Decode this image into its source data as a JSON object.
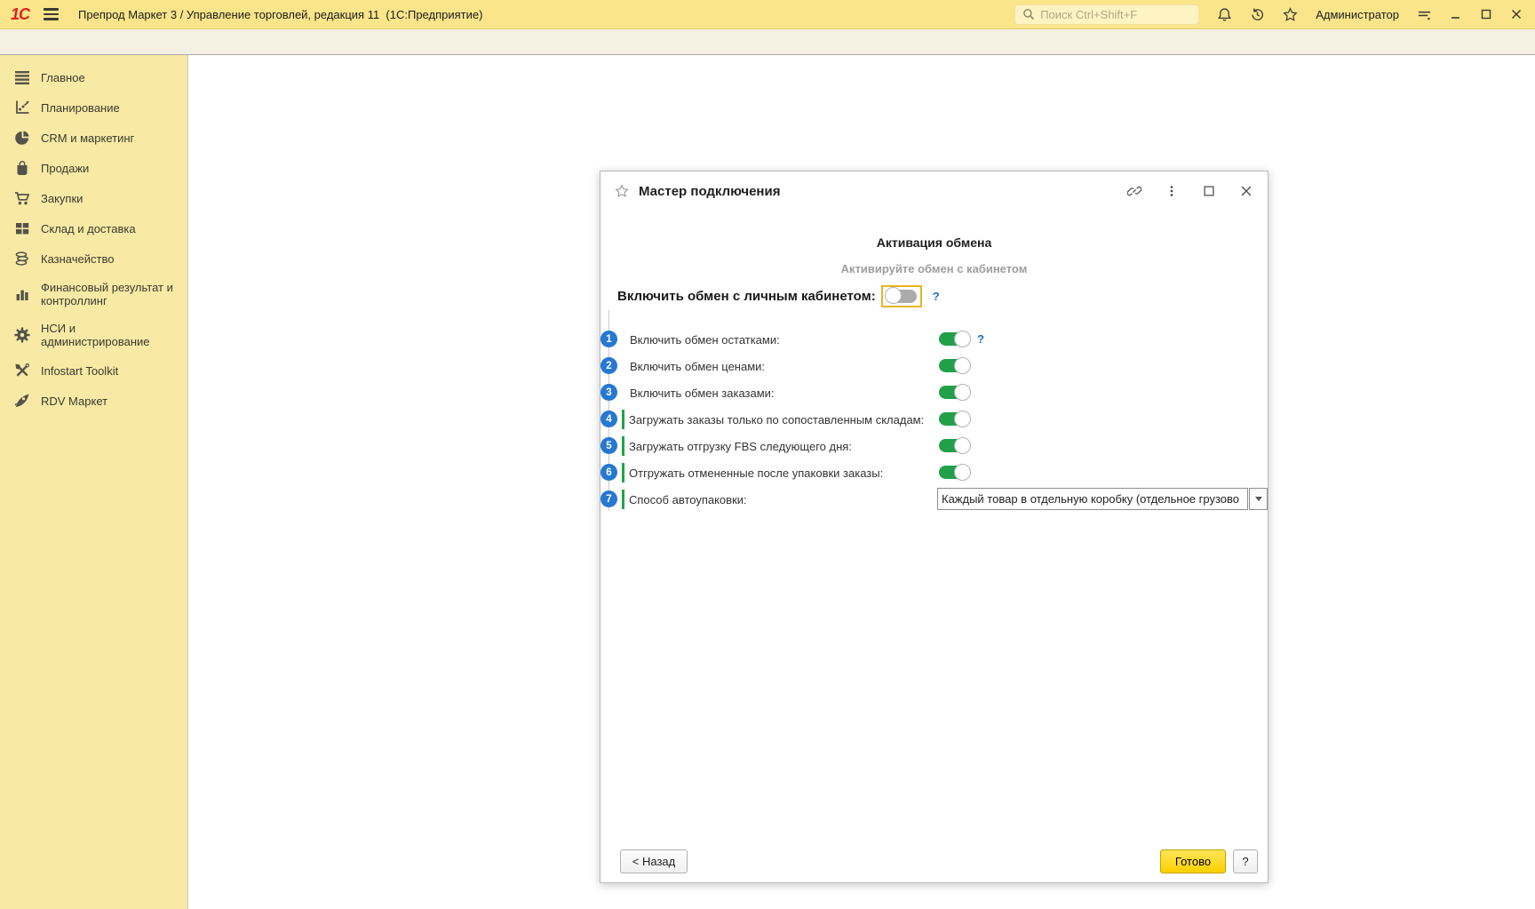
{
  "app": {
    "logo": "1С",
    "title": "Препрод Маркет 3 / Управление торговлей, редакция 11  (1С:Предприятие)",
    "search_placeholder": "Поиск Ctrl+Shift+F",
    "user": "Администратор"
  },
  "sidebar": {
    "items": [
      {
        "label": "Главное",
        "icon": "menu-icon"
      },
      {
        "label": "Планирование",
        "icon": "planning-icon"
      },
      {
        "label": "CRM и маркетинг",
        "icon": "pie-chart-icon"
      },
      {
        "label": "Продажи",
        "icon": "bag-icon"
      },
      {
        "label": "Закупки",
        "icon": "cart-icon"
      },
      {
        "label": "Склад и доставка",
        "icon": "grid-icon"
      },
      {
        "label": "Казначейство",
        "icon": "coins-icon"
      },
      {
        "label": "Финансовый результат и контроллинг",
        "icon": "bar-chart-icon"
      },
      {
        "label": "НСИ и администрирование",
        "icon": "gear-icon"
      },
      {
        "label": "Infostart Toolkit",
        "icon": "tools-icon"
      },
      {
        "label": "RDV Маркет",
        "icon": "rocket-icon"
      }
    ]
  },
  "dialog": {
    "title": "Мастер подключения",
    "step_title": "Активация обмена",
    "step_subtitle": "Активируйте обмен с кабинетом",
    "main_toggle": {
      "label": "Включить обмен с личным кабинетом:",
      "state": "off",
      "help": "?"
    },
    "rows": [
      {
        "num": "1",
        "label": "Включить обмен остатками:",
        "type": "toggle",
        "state": "on",
        "help": "?",
        "indent": false
      },
      {
        "num": "2",
        "label": "Включить обмен ценами:",
        "type": "toggle",
        "state": "on",
        "indent": false
      },
      {
        "num": "3",
        "label": "Включить обмен заказами:",
        "type": "toggle",
        "state": "on",
        "indent": false
      },
      {
        "num": "4",
        "label": "Загружать заказы только по сопоставленным складам:",
        "type": "toggle",
        "state": "on",
        "indent": true
      },
      {
        "num": "5",
        "label": "Загружать отгрузку FBS следующего дня:",
        "type": "toggle",
        "state": "on",
        "indent": true
      },
      {
        "num": "6",
        "label": "Отгружать отмененные после упаковки заказы:",
        "type": "toggle",
        "state": "on",
        "indent": true
      },
      {
        "num": "7",
        "label": "Способ автоупаковки:",
        "type": "select",
        "value": "Каждый товар в отдельную коробку (отдельное грузово",
        "indent": true
      }
    ],
    "buttons": {
      "back": "< Назад",
      "finish": "Готово",
      "help": "?"
    }
  },
  "colors": {
    "topbar": "#fbe58a",
    "sidebar": "#f8e9a5",
    "logo_red": "#e31e24",
    "toggle_green": "#21a049",
    "step_blue": "#2678d1",
    "help_blue": "#1b6ec2",
    "finish_yellow": "#fed000",
    "focus_gold": "#e9b41f"
  }
}
